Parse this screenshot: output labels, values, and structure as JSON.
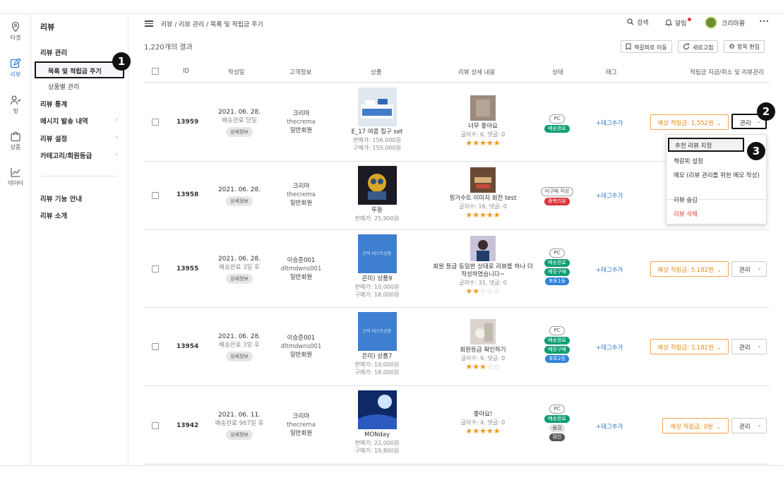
{
  "rail": [
    {
      "label": "타겟",
      "icon": "location-pin-icon"
    },
    {
      "label": "리뷰",
      "icon": "edit-review-icon",
      "active": true
    },
    {
      "label": "핏",
      "icon": "person-check-icon"
    },
    {
      "label": "상품",
      "icon": "shopping-bag-icon"
    },
    {
      "label": "데이터",
      "icon": "line-chart-icon"
    }
  ],
  "subnav": {
    "title": "리뷰",
    "manage": "리뷰 관리",
    "list_points": "목록 및 적립금 주기",
    "by_product": "상품별 관리",
    "stats": "리뷰 통계",
    "messages": "메시지 발송 내역",
    "settings": "리뷰 설정",
    "category": "카테고리/회원등급",
    "guide": "리뷰 기능 안내",
    "intro": "리뷰 소개"
  },
  "callouts": {
    "one": "1",
    "two": "2",
    "three": "3"
  },
  "header": {
    "breadcrumb": "리뷰 / 리뷰 관리 / 목록 및 적립금 주기",
    "search": "검색",
    "alerts": "알림",
    "user": "크리마몰",
    "more": "•••"
  },
  "results": "1,220개의 결과",
  "toolbar": {
    "bookmark": "책갈피로 이동",
    "refresh": "새로고침",
    "edit_columns": "항목 편집"
  },
  "columns": {
    "id": "ID",
    "date": "작성일",
    "customer": "고객정보",
    "product": "상품",
    "review": "리뷰 상세 내용",
    "status": "상태",
    "tag": "태그",
    "action": "적립금 지급/취소 및 리뷰관리"
  },
  "rows": [
    {
      "id": "13959",
      "date": "2021. 06. 28.",
      "delivery": "배송완료 당일",
      "detail": "상세정보",
      "cust_name": "크리마",
      "cust_id": "thecrema",
      "cust_grade": "일반회원",
      "product": "E_17 여름 침구 set",
      "sale_price": "판매가: 156,000원",
      "buy_price": "구매가: 155,000원",
      "review_title": "너무 좋아요",
      "review_meta": "글자수: 6, 댓글: 0",
      "rating": 5,
      "status": [
        "PC",
        "배송완료"
      ],
      "tag": "+태그추가",
      "points": "예상 적립금: 1,552원",
      "manage": "관리"
    },
    {
      "id": "13958",
      "date": "2021. 06. 28.",
      "delivery": "",
      "detail": "상세정보",
      "cust_name": "크리마",
      "cust_id": "thecrema",
      "cust_grade": "일반회원",
      "product": "뚜둥",
      "sale_price": "판매가: 25,900원",
      "buy_price": "",
      "review_title": "핑거수트 이미지 회전 test",
      "review_meta": "글자수: 16, 댓글: 0",
      "rating": 5,
      "status": [
        "미구매 작성",
        "중복리뷰"
      ],
      "tag": "+태그추가",
      "points": "",
      "manage": ""
    },
    {
      "id": "13955",
      "date": "2021. 06. 28.",
      "delivery": "배송완료 3일 후",
      "detail": "상세정보",
      "cust_name": "이승준001",
      "cust_id": "dltmdwns001",
      "cust_grade": "일반회원",
      "product": "은미) 상품9",
      "product_img_text": "은미 테스트상품",
      "sale_price": "판매가: 10,000원",
      "buy_price": "구매가: 18,000원",
      "review_title": "회원 등급 동일한 상태로 리뷰를 하나 더",
      "review_title2": "작성하였습니다~",
      "review_meta": "글자수: 31, 댓글: 0",
      "rating": 2,
      "status": [
        "PC",
        "배송완료",
        "매장구매",
        "포토1등"
      ],
      "tag": "+태그추가",
      "points": "예상 적립금: 5,182원",
      "manage": "관리"
    },
    {
      "id": "13954",
      "date": "2021. 06. 28.",
      "delivery": "배송완료 3일 후",
      "detail": "상세정보",
      "cust_name": "이승준001",
      "cust_id": "dltmdwns001",
      "cust_grade": "일반회원",
      "product": "은미) 상품7",
      "product_img_text": "은미 테스트상품",
      "sale_price": "판매가: 10,000원",
      "buy_price": "구매가: 18,000원",
      "review_title": "회원등급 확인하기",
      "review_meta": "글자수: 9, 댓글: 0",
      "rating": 3,
      "status": [
        "PC",
        "배송완료",
        "매장구매",
        "포토2등"
      ],
      "tag": "+태그추가",
      "points": "예상 적립금: 3,182원",
      "manage": "관리"
    },
    {
      "id": "13942",
      "date": "2021. 06. 11.",
      "delivery": "배송완료 967일 후",
      "detail": "상세정보",
      "cust_name": "크리마",
      "cust_id": "thecrema",
      "cust_grade": "일반회원",
      "product": "MONday",
      "sale_price": "판매가: 22,000원",
      "buy_price": "구매가: 19,800원",
      "review_title": "좋아요!",
      "review_meta": "글자수: 4, 댓글: 0",
      "rating": 5,
      "status": [
        "PC",
        "배송완료",
        "숨김",
        "확인"
      ],
      "tag": "+태그추가",
      "points": "예상 적립금: 0원",
      "manage": "관리"
    }
  ],
  "dropdown": {
    "recommend": "추천 리뷰 지정",
    "bookmark": "책갈피 설정",
    "memo": "메모 (리뷰 관리를 위한 메모 작성)",
    "hide": "리뷰 숨김",
    "delete": "리뷰 삭제"
  },
  "colors": {
    "accent": "#2b7bd6",
    "points": "#e58a17",
    "star": "#f2961d",
    "status_green": "#0f9c74",
    "status_blue": "#2e83dc",
    "status_red": "#d9343d"
  }
}
